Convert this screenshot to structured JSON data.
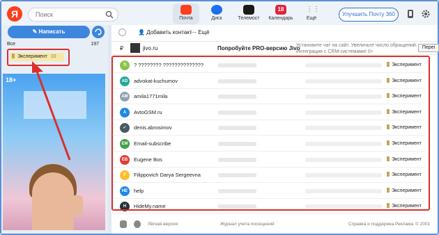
{
  "header": {
    "logo": "Я",
    "search_placeholder": "Поиск",
    "apps": [
      {
        "label": "Почта",
        "color": "#fc3f1d"
      },
      {
        "label": "Диск",
        "color": "#1e6ff0"
      },
      {
        "label": "Телемост",
        "color": "#1a1a1a"
      },
      {
        "label": "Календарь",
        "color": "#e5213d"
      },
      {
        "label": "Ещё",
        "color": "#888888"
      }
    ],
    "calendar_day": "18",
    "upgrade_label": "Улучшить Почту 360"
  },
  "sidebar": {
    "compose_label": "Написать",
    "folders": [
      {
        "label": "Все",
        "count": "197"
      },
      {
        "label": "Эксперимент",
        "count": "10"
      }
    ],
    "ad_badge": "18+"
  },
  "toolbar": {
    "add_contact": "Добавить контакт",
    "more": "Ещё"
  },
  "promo": {
    "currency": "₽",
    "from": "jivo.ru",
    "subject": "Попробуйте PRO-версию Jivo",
    "description": "Установите чат на сайт. Увеличьте число обращений. Интеграция с CRM-системами! 0+",
    "button": "Переі"
  },
  "messages": [
    {
      "initials": "TI",
      "color": "#8bc34a",
      "name": "? ???????? ??????????????",
      "label": "Эксперимент"
    },
    {
      "initials": "AD",
      "color": "#26a69a",
      "name": "advokat-kuchumov",
      "label": "Эксперимент"
    },
    {
      "initials": "AM",
      "color": "#90a4ae",
      "name": "amila1771mila",
      "label": "Эксперимент"
    },
    {
      "initials": "A",
      "color": "#1e88e5",
      "name": "AvtoGSM.ru",
      "label": "Эксперимент"
    },
    {
      "initials": "✓",
      "color": "#455a64",
      "name": "denis.abrosimov",
      "label": "Эксперимент"
    },
    {
      "initials": "EM",
      "color": "#43a047",
      "name": "Email-subscribe",
      "label": "Эксперимент"
    },
    {
      "initials": "EB",
      "color": "#e53935",
      "name": "Eugene Bos",
      "label": "Эксперимент"
    },
    {
      "initials": "F",
      "color": "#fbc02d",
      "name": "Filippovich Darya Sergeevna",
      "label": "Эксперимент"
    },
    {
      "initials": "HE",
      "color": "#1e88e5",
      "name": "help",
      "label": "Эксперимент"
    },
    {
      "initials": "H",
      "color": "#263238",
      "name": "HideMy.name",
      "label": "Эксперимент"
    }
  ],
  "footer": {
    "light_version": "Лёгкая версия",
    "visits_log": "Журнал учета посещений",
    "help": "Справка и поддержка",
    "ads": "Реклама",
    "copyright": "© 2001"
  }
}
